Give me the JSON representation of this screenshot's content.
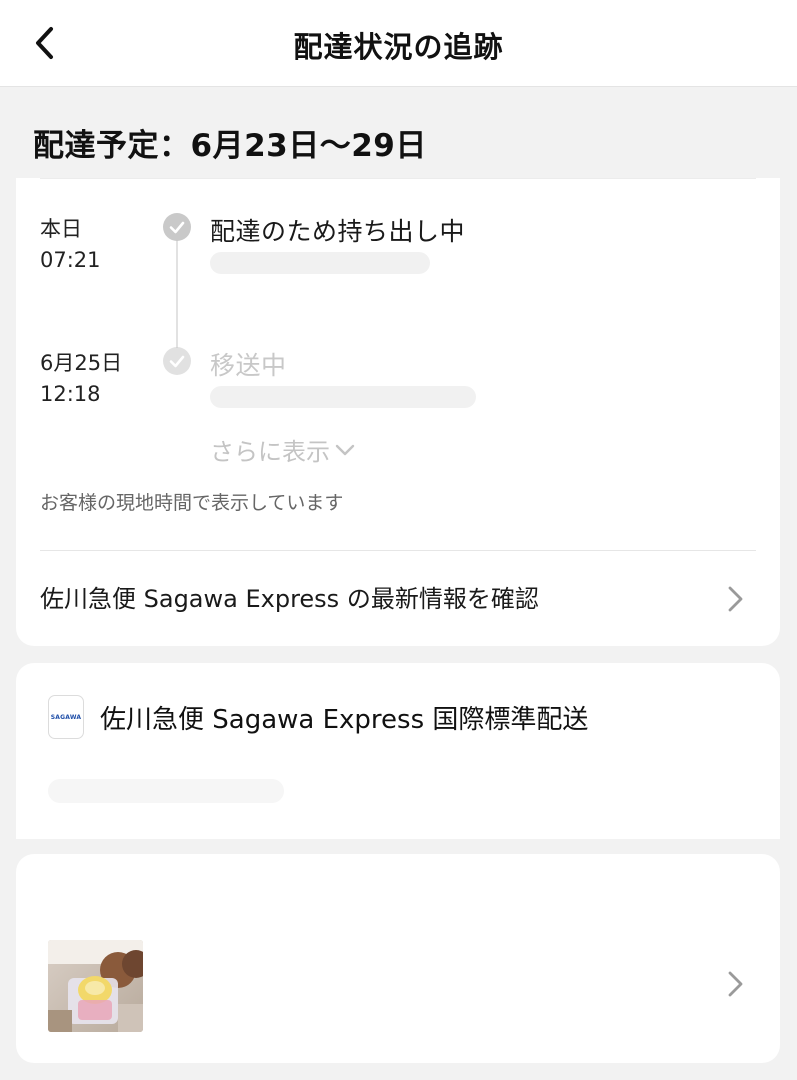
{
  "header": {
    "title": "配達状況の追跡",
    "back_icon": "chevron-left-icon"
  },
  "delivery_estimate": "配達予定：6月23日〜29日",
  "tracking": {
    "events": [
      {
        "date": "本日",
        "time": "07:21",
        "title": "配達のため持ち出し中",
        "status": "completed"
      },
      {
        "date": "6月25日",
        "time": "12:18",
        "title": "移送中",
        "status": "completed"
      }
    ],
    "show_more_label": "さらに表示",
    "timezone_note": "お客様の現地時間で表示しています",
    "carrier_link_label": "佐川急便 Sagawa Express の最新情報を確認"
  },
  "carrier": {
    "logo_text": "SAGAWA",
    "name": "佐川急便 Sagawa Express 国際標準配送"
  },
  "colors": {
    "background": "#f2f2f2",
    "card": "#ffffff",
    "check_dot": "#c9c9c9",
    "logo_blue": "#1f4ea8"
  }
}
